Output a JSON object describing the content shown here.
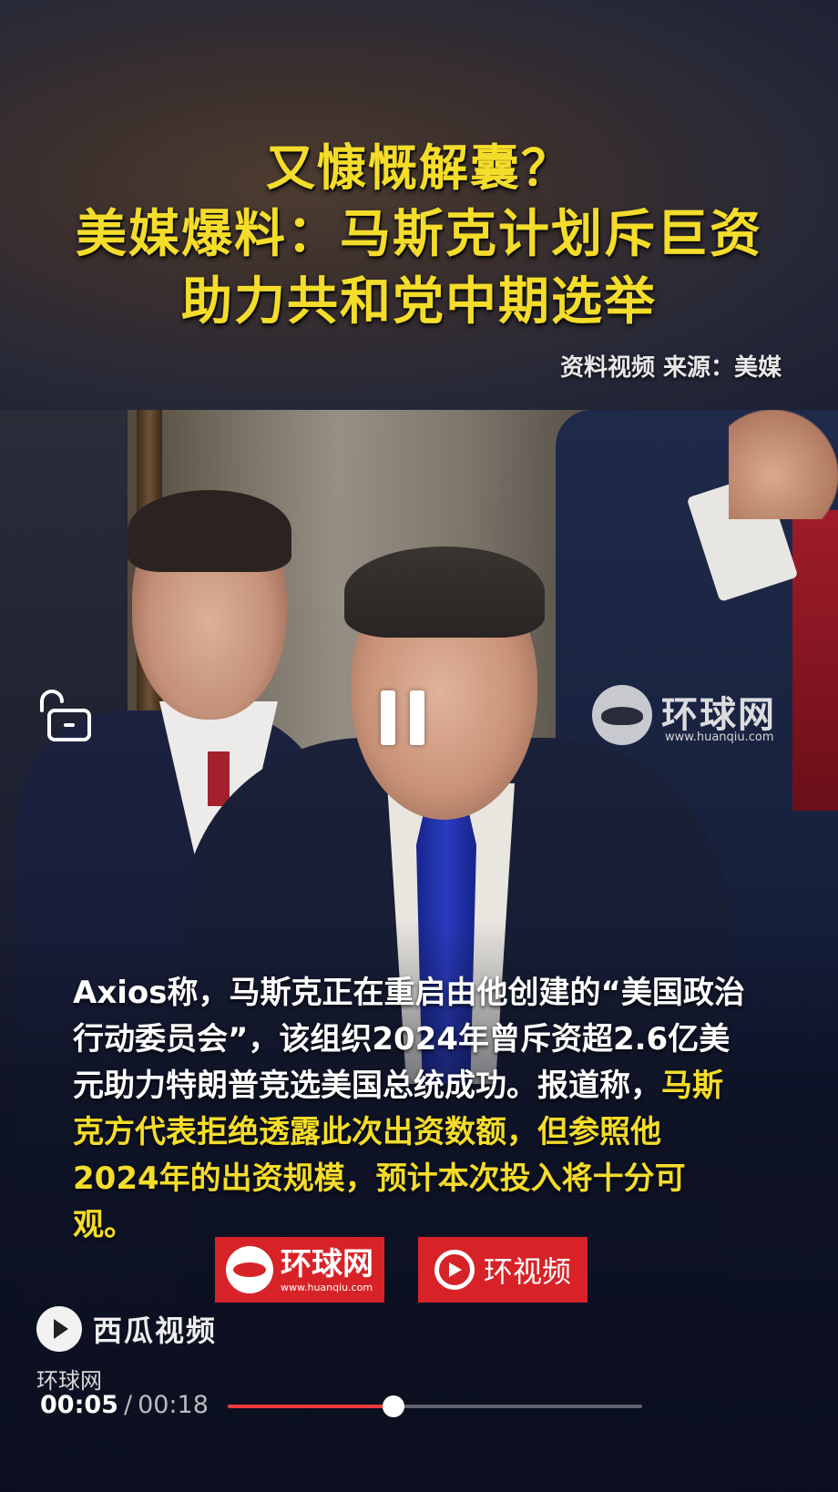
{
  "banner": {
    "headline_line1": "又慷慨解囊？",
    "headline_line2": "美媒爆料：马斯克计划斥巨资",
    "headline_line3": "助力共和党中期选举",
    "source": "资料视频 来源：美媒",
    "headline_color": "#f4dc2a"
  },
  "video": {
    "watermark_text": "环球网",
    "watermark_url": "www.huanqiu.com",
    "caption_white": "Axios称，马斯克正在重启由他创建的“美国政治行动委员会”，该组织2024年曾斥资超2.6亿美元助力特朗普竞选美国总统成功。报道称，",
    "caption_yellow": "马斯克方代表拒绝透露此次出资数额，但参照他2024年的出资规模，预计本次投入将十分可观。",
    "logo_left_text": "环球网",
    "logo_left_url": "www.huanqiu.com",
    "logo_right_text": "环视频",
    "logo_color": "#d72328",
    "lock_icon": "unlock-icon",
    "pause_icon": "pause-icon"
  },
  "player": {
    "platform": "西瓜视频",
    "author": "环球网",
    "current_time": "00:05",
    "separator": "/",
    "total_time": "00:18",
    "progress_fraction": 0.4,
    "progress_color": "#ee3a3a"
  }
}
